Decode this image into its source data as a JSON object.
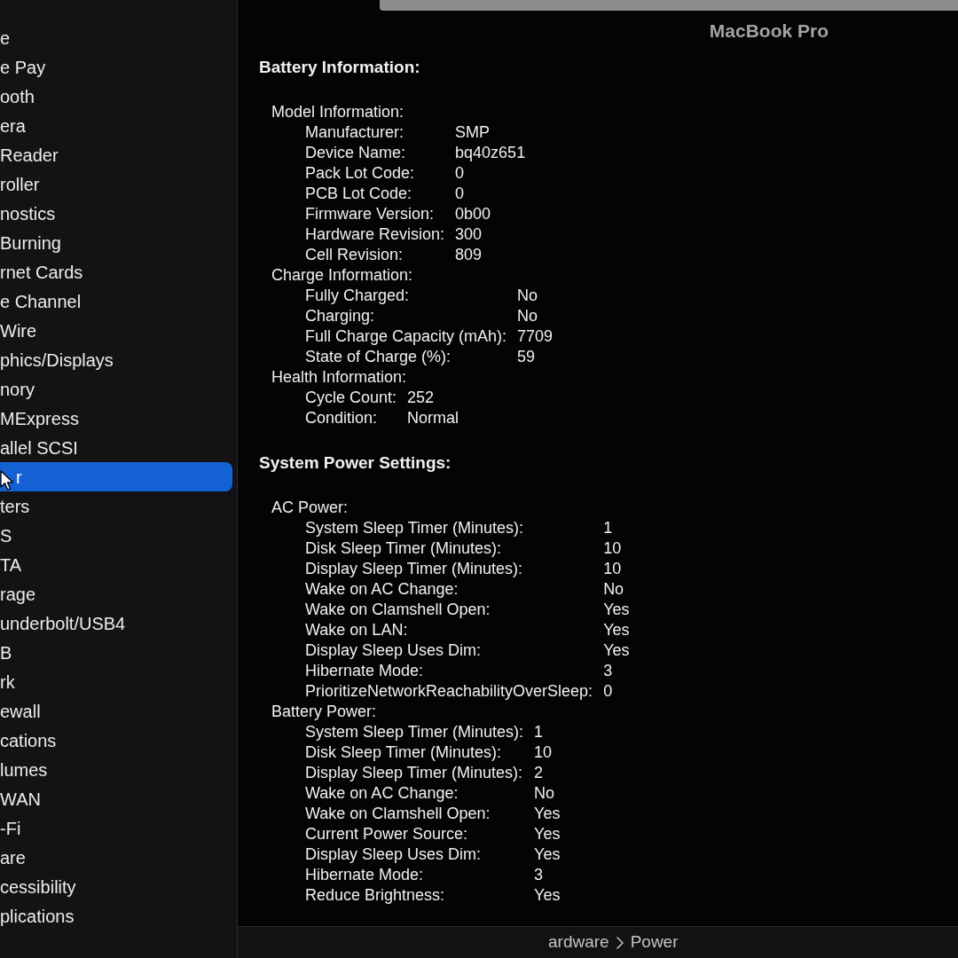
{
  "window": {
    "title": "MacBook Pro"
  },
  "sidebar": {
    "items": [
      {
        "label": "e",
        "selected": false,
        "children": [
          {
            "label": "e Pay",
            "selected": false
          },
          {
            "label": "ooth",
            "selected": false
          },
          {
            "label": "era",
            "selected": false
          },
          {
            "label": "Reader",
            "selected": false
          },
          {
            "label": "roller",
            "selected": false
          },
          {
            "label": "nostics",
            "selected": false
          },
          {
            "label": "Burning",
            "selected": false
          },
          {
            "label": "rnet Cards",
            "selected": false
          },
          {
            "label": "e Channel",
            "selected": false
          },
          {
            "label": "Wire",
            "selected": false
          },
          {
            "label": "phics/Displays",
            "selected": false
          },
          {
            "label": "nory",
            "selected": false
          },
          {
            "label": "MExpress",
            "selected": false
          },
          {
            "label": "allel SCSI",
            "selected": false
          },
          {
            "label": "r",
            "selected": true
          },
          {
            "label": "ters",
            "selected": false
          },
          {
            "label": "S",
            "selected": false
          },
          {
            "label": "TA",
            "selected": false
          },
          {
            "label": "rage",
            "selected": false
          },
          {
            "label": "underbolt/USB4",
            "selected": false
          },
          {
            "label": "B",
            "selected": false
          }
        ]
      },
      {
        "label": "rk",
        "selected": false,
        "children": [
          {
            "label": "ewall",
            "selected": false
          },
          {
            "label": "cations",
            "selected": false
          },
          {
            "label": "lumes",
            "selected": false
          },
          {
            "label": "WAN",
            "selected": false
          },
          {
            "label": "-Fi",
            "selected": false
          }
        ]
      },
      {
        "label": "are",
        "selected": false,
        "children": [
          {
            "label": "cessibility",
            "selected": false
          },
          {
            "label": "plications",
            "selected": false
          }
        ]
      }
    ]
  },
  "content": {
    "sections": [
      {
        "title": "Battery Information:",
        "groups": [
          {
            "title": "Model Information:",
            "rows": [
              {
                "label": "Manufacturer:",
                "value": "SMP"
              },
              {
                "label": "Device Name:",
                "value": "bq40z651"
              },
              {
                "label": "Pack Lot Code:",
                "value": "0"
              },
              {
                "label": "PCB Lot Code:",
                "value": "0"
              },
              {
                "label": "Firmware Version:",
                "value": "0b00"
              },
              {
                "label": "Hardware Revision:",
                "value": "300"
              },
              {
                "label": "Cell Revision:",
                "value": "809"
              }
            ]
          },
          {
            "title": "Charge Information:",
            "rows": [
              {
                "label": "Fully Charged:",
                "value": "No"
              },
              {
                "label": "Charging:",
                "value": "No"
              },
              {
                "label": "Full Charge Capacity (mAh):",
                "value": "7709"
              },
              {
                "label": "State of Charge (%):",
                "value": "59"
              }
            ]
          },
          {
            "title": "Health Information:",
            "rows": [
              {
                "label": "Cycle Count:",
                "value": "252"
              },
              {
                "label": "Condition:",
                "value": "Normal"
              }
            ]
          }
        ]
      },
      {
        "title": "System Power Settings:",
        "groups": [
          {
            "title": "AC Power:",
            "rows": [
              {
                "label": "System Sleep Timer (Minutes):",
                "value": "1"
              },
              {
                "label": "Disk Sleep Timer (Minutes):",
                "value": "10"
              },
              {
                "label": "Display Sleep Timer (Minutes):",
                "value": "10"
              },
              {
                "label": "Wake on AC Change:",
                "value": "No"
              },
              {
                "label": "Wake on Clamshell Open:",
                "value": "Yes"
              },
              {
                "label": "Wake on LAN:",
                "value": "Yes"
              },
              {
                "label": "Display Sleep Uses Dim:",
                "value": "Yes"
              },
              {
                "label": "Hibernate Mode:",
                "value": "3"
              },
              {
                "label": "PrioritizeNetworkReachabilityOverSleep:",
                "value": "0"
              }
            ]
          },
          {
            "title": "Battery Power:",
            "rows": [
              {
                "label": "System Sleep Timer (Minutes):",
                "value": "1"
              },
              {
                "label": "Disk Sleep Timer (Minutes):",
                "value": "10"
              },
              {
                "label": "Display Sleep Timer (Minutes):",
                "value": "2"
              },
              {
                "label": "Wake on AC Change:",
                "value": "No"
              },
              {
                "label": "Wake on Clamshell Open:",
                "value": "Yes"
              },
              {
                "label": "Current Power Source:",
                "value": "Yes"
              },
              {
                "label": "Display Sleep Uses Dim:",
                "value": "Yes"
              },
              {
                "label": "Hibernate Mode:",
                "value": "3"
              },
              {
                "label": "Reduce Brightness:",
                "value": "Yes"
              }
            ]
          }
        ]
      }
    ]
  },
  "path_bar": {
    "items": [
      "ardware",
      "Power"
    ]
  }
}
